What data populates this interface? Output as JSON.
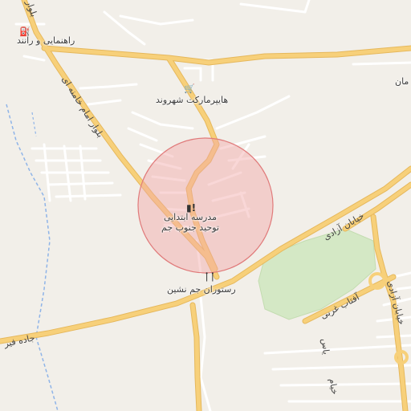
{
  "map": {
    "labels": {
      "school": "مدرسه ابتدایی\nتوحید جنوب جم",
      "hypermarket": "هایپرمارکت شهروند",
      "restaurant": "رستوران جم نشین",
      "driving_school": "راهنمایی و رانند",
      "blvd_imam": "بلوار امام خامنه ای",
      "azadi_st": "خیابان آزادی",
      "azadi_st_2": "خیابان آزادی",
      "aftab_gharbi": "آفتاب غربی",
      "khayyam": "خیام",
      "road_fi": "جاده فیر",
      "blvd_top": "بلوار",
      "right_edge": "مان",
      "lower_vertical": "یاس"
    },
    "icons": {
      "school": "school-icon",
      "hypermarket": "shopping-cart-icon",
      "restaurant": "fork-knife-icon",
      "driving_school": "driving-school-icon"
    },
    "colors": {
      "background": "#f2efe9",
      "major_road": "#f7d07a",
      "major_road_casing": "#e6b85c",
      "minor_road": "#ffffff",
      "park": "#d4e8c5",
      "highlight_circle_fill": "#f2a6a6",
      "highlight_circle_stroke": "#e07a7a",
      "waterway": "#8fb4e8"
    }
  }
}
